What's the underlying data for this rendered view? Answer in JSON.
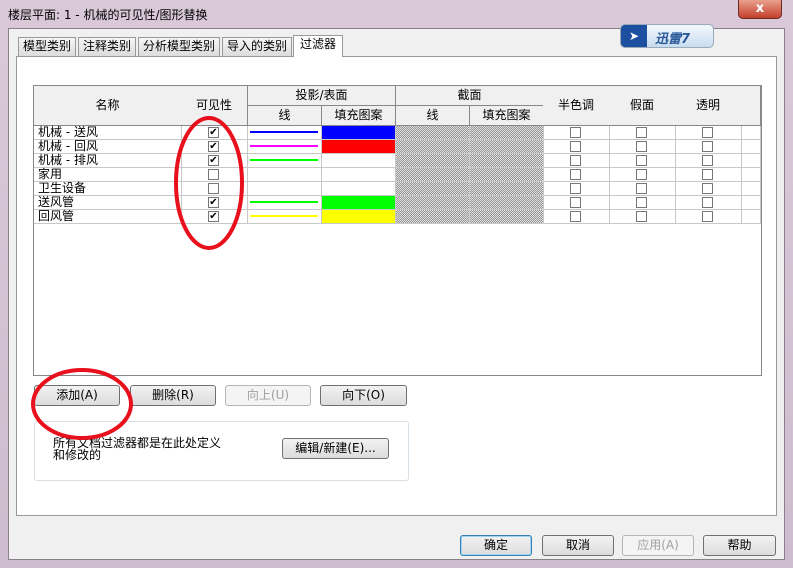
{
  "window": {
    "title": "楼层平面: 1 - 机械的可见性/图形替换",
    "close": "x"
  },
  "logo": {
    "text": "迅雷7"
  },
  "tabs": [
    "模型类别",
    "注释类别",
    "分析模型类别",
    "导入的类别",
    "过滤器"
  ],
  "active_tab": "过滤器",
  "table": {
    "headers": {
      "name": "名称",
      "visibility": "可见性",
      "projection": "投影/表面",
      "cut": "截面",
      "line": "线",
      "fill": "填充图案",
      "cut_line": "线",
      "cut_fill": "填充图案",
      "halftone": "半色调",
      "ghost": "假面",
      "transparent": "透明"
    },
    "rows": [
      {
        "name": "机械 - 送风",
        "visible": true,
        "line_color": "#0000ff",
        "fill_color": "#0000ff"
      },
      {
        "name": "机械 - 回风",
        "visible": true,
        "line_color": "#ff00ff",
        "fill_color": "#ff0000"
      },
      {
        "name": "机械 - 排风",
        "visible": true,
        "line_color": "#00ff00",
        "fill_color": ""
      },
      {
        "name": "家用",
        "visible": false,
        "line_color": "",
        "fill_color": ""
      },
      {
        "name": "卫生设备",
        "visible": false,
        "line_color": "",
        "fill_color": ""
      },
      {
        "name": "送风管",
        "visible": true,
        "line_color": "#00ff00",
        "fill_color": "#00ff00"
      },
      {
        "name": "回风管",
        "visible": true,
        "line_color": "#ffff00",
        "fill_color": "#ffff00"
      }
    ]
  },
  "buttons": {
    "add": "添加(A)",
    "delete": "删除(R)",
    "up": "向上(U)",
    "down": "向下(O)",
    "edit": "编辑/新建(E)...",
    "ok": "确定",
    "cancel": "取消",
    "apply": "应用(A)",
    "help": "帮助"
  },
  "info": "所有文档过滤器都是在此处定义和修改的",
  "annotation_color": "#e8101c"
}
